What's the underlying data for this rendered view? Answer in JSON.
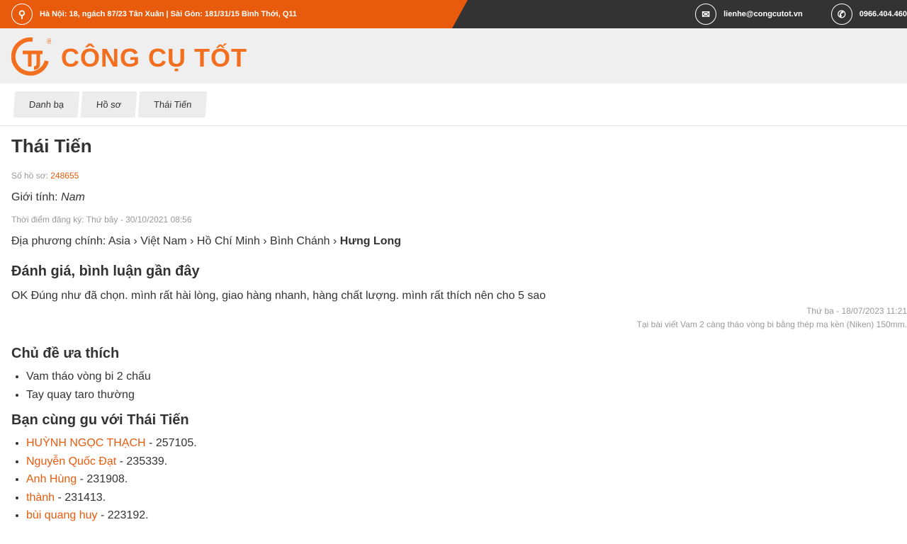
{
  "topbar": {
    "address": "Hà Nội: 18, ngách 87/23 Tân Xuân | Sài Gòn: 181/31/15 Bình Thới, Q11",
    "email": "lienhe@congcutot.vn",
    "phone": "0966.404.460"
  },
  "logo": {
    "text": "CÔNG CỤ TỐT",
    "registered": "®",
    "brand_color": "#f26f1f"
  },
  "breadcrumb": [
    "Danh bạ",
    "Hồ sơ",
    "Thái Tiến"
  ],
  "profile": {
    "name": "Thái Tiến",
    "id_label": "Số hồ sơ:",
    "id": "248655",
    "gender_label": "Giới tính:",
    "gender": "Nam",
    "registered": "Thời điểm đăng ký: Thứ bảy - 30/10/2021 08:56",
    "location_label": "Địa phương chính:",
    "location_path": "Asia › Việt Nam › Hồ Chí Minh › Bình Chánh ›",
    "location_last": "Hưng Long"
  },
  "reviews": {
    "title": "Đánh giá, bình luận gần đây",
    "items": [
      {
        "text": "OK Đúng như đã chọn. mình rất hài lòng, giao hàng nhanh, hàng chất lượng. mình rất thích nên cho 5 sao",
        "date": "Thứ ba - 18/07/2023 11:21",
        "post": "Tại bài viết Vam 2 càng tháo vòng bi bằng thép mạ kền (Niken) 150mm."
      }
    ]
  },
  "topics": {
    "title": "Chủ đề ưa thích",
    "items": [
      "Vam tháo vòng bi 2 chấu",
      "Tay quay taro thường"
    ]
  },
  "friends": {
    "title": "Bạn cùng gu với Thái Tiến",
    "items": [
      {
        "name": "HUỲNH NGỌC THẠCH",
        "num": " - 257105."
      },
      {
        "name": "Nguyễn Quốc Đạt",
        "num": " - 235339."
      },
      {
        "name": "Anh Hùng",
        "num": " - 231908."
      },
      {
        "name": "thành",
        "num": " - 231413."
      },
      {
        "name": "bùi quang huy",
        "num": " - 223192."
      }
    ]
  }
}
